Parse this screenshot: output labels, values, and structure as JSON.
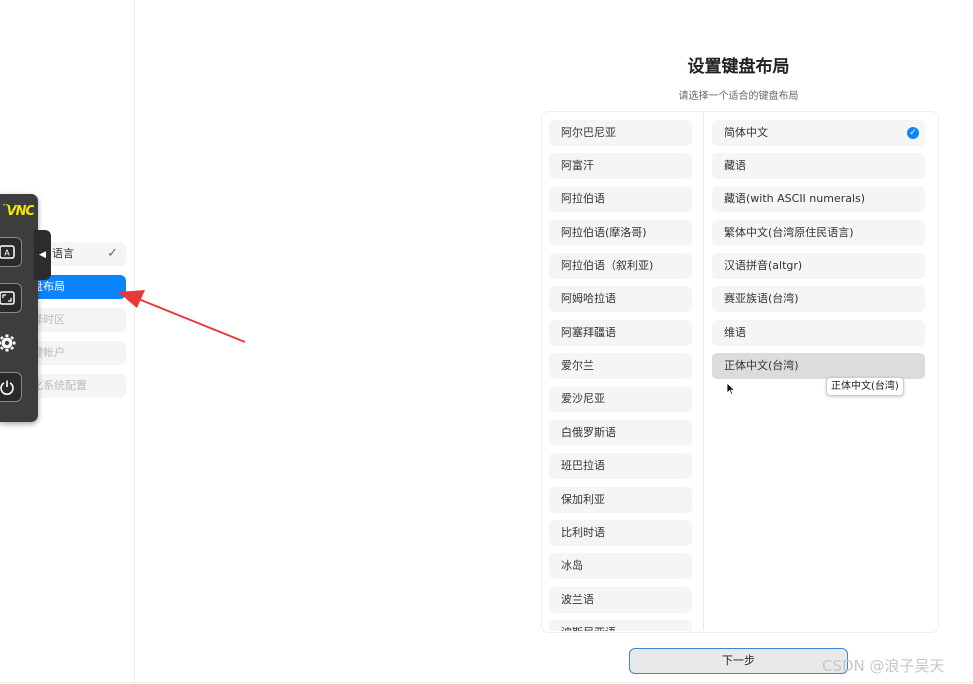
{
  "sidebar": {
    "steps": [
      {
        "label": "语言",
        "state": "done"
      },
      {
        "label": "盘布局",
        "state": "active"
      },
      {
        "label": "择时区",
        "state": "pending"
      },
      {
        "label": "键帐户",
        "state": "pending"
      },
      {
        "label": "化系统配置",
        "state": "pending"
      }
    ]
  },
  "vnc_toolbar": {
    "logo_text": "VNC",
    "icons": [
      "keyboard-icon",
      "fullscreen-icon",
      "gear-icon",
      "power-icon"
    ]
  },
  "main": {
    "title": "设置键盘布局",
    "subtitle": "请选择一个适合的键盘布局",
    "left_list": [
      "阿尔巴尼亚",
      "阿富汗",
      "阿拉伯语",
      "阿拉伯语(摩洛哥)",
      "阿拉伯语（叙利亚)",
      "阿姆哈拉语",
      "阿塞拜疆语",
      "爱尔兰",
      "爱沙尼亚",
      "白俄罗斯语",
      "班巴拉语",
      "保加利亚",
      "比利时语",
      "冰岛",
      "波兰语",
      "波斯尼亚语"
    ],
    "right_list": [
      "简体中文",
      "藏语",
      "藏语(with ASCII numerals)",
      "繁体中文(台湾原住民语言)",
      "汉语拼音(altgr)",
      "赛亚族语(台湾)",
      "维语",
      "正体中文(台湾)"
    ],
    "selected": "简体中文",
    "hovered": "正体中文(台湾)",
    "tooltip": "正体中文(台湾)",
    "next_button": "下一步"
  },
  "watermark": "CSDN @浪子吴天",
  "colors": {
    "accent": "#0a84ff",
    "arrow": "#e8393a"
  }
}
